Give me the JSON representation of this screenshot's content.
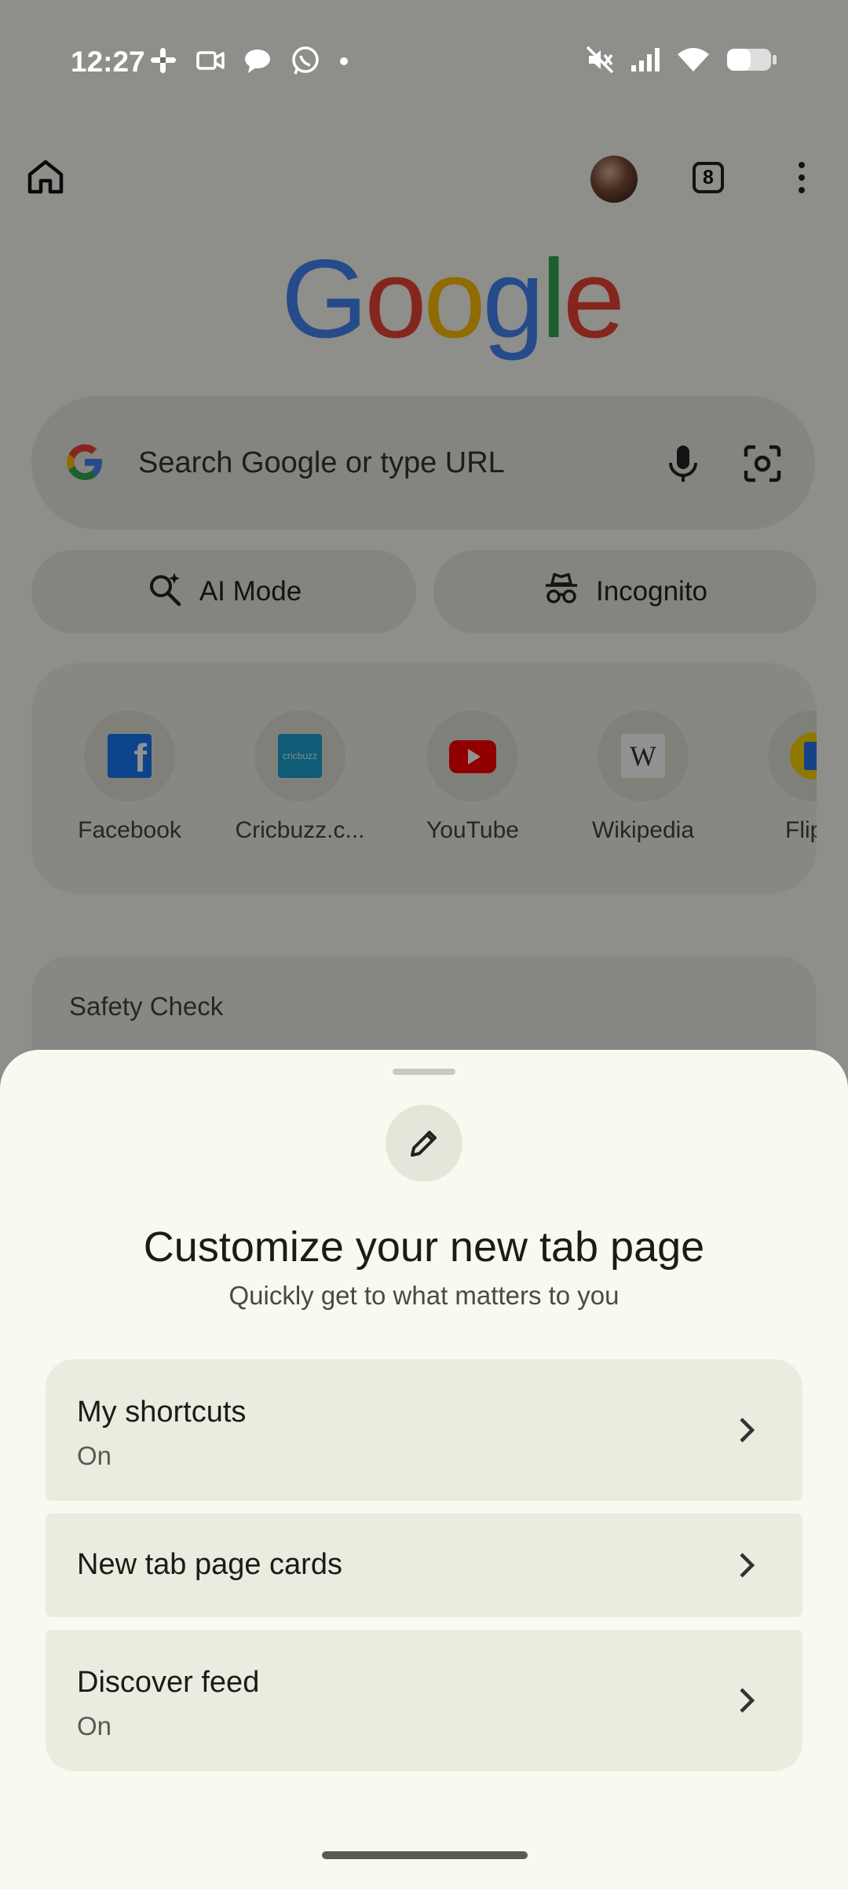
{
  "status_bar": {
    "time": "12:27",
    "left_icons": [
      "slack-icon",
      "video-icon",
      "chat-icon",
      "whatsapp-icon",
      "dot-icon"
    ],
    "right_icons": [
      "mute-icon",
      "signal-icon",
      "wifi-icon",
      "battery-icon"
    ]
  },
  "toolbar": {
    "tab_count": "8"
  },
  "logo": {
    "letters": [
      "G",
      "o",
      "o",
      "g",
      "l",
      "e"
    ]
  },
  "search": {
    "placeholder": "Search Google or type URL"
  },
  "quick_actions": {
    "ai_mode": "AI Mode",
    "incognito": "Incognito"
  },
  "shortcuts": [
    {
      "label": "Facebook",
      "icon": "facebook-icon",
      "color": "#1877f2"
    },
    {
      "label": "Cricbuzz.c...",
      "icon": "cricbuzz-icon",
      "color": "#1aa3d0"
    },
    {
      "label": "YouTube",
      "icon": "youtube-icon",
      "color": "#ff0000"
    },
    {
      "label": "Wikipedia",
      "icon": "wikipedia-icon",
      "color": "#ffffff"
    },
    {
      "label": "Flipkar",
      "icon": "flipkart-icon",
      "color": "#fbd300"
    }
  ],
  "safety_check": {
    "title": "Safety Check"
  },
  "sheet": {
    "title": "Customize your new tab page",
    "subtitle": "Quickly get to what matters to you",
    "options": [
      {
        "title": "My shortcuts",
        "state": "On"
      },
      {
        "title": "New tab page cards",
        "state": ""
      },
      {
        "title": "Discover feed",
        "state": "On"
      }
    ]
  },
  "colors": {
    "google_blue": "#4285f4",
    "google_red": "#ea4335",
    "google_yellow": "#fbbc05",
    "google_green": "#34a853",
    "sheet_bg": "#f9f9f0",
    "option_bg": "#ebebe0"
  }
}
